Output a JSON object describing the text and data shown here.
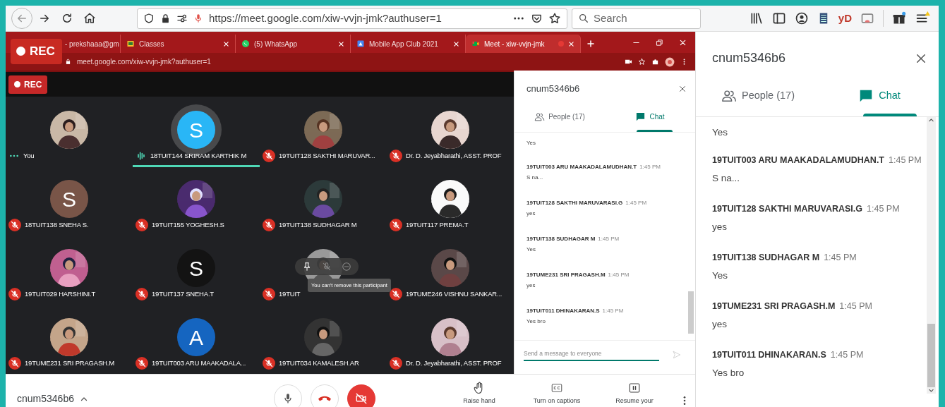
{
  "browser": {
    "url": "https://meet.google.com/xiw-vvjn-jmk?authuser=1",
    "search_placeholder": "Search",
    "extension_label": "yD"
  },
  "recording_badge": "REC",
  "chrome": {
    "tabs": [
      {
        "label": "- prekshaaa@gm",
        "selected": false
      },
      {
        "label": "Classes",
        "kind": "classroom",
        "selected": false
      },
      {
        "label": "(5) WhatsApp",
        "kind": "whatsapp",
        "selected": false
      },
      {
        "label": "Mobile App Club 2021",
        "kind": "app",
        "selected": false
      },
      {
        "label": "Meet - xiw-vvjn-jmk",
        "kind": "meet",
        "selected": true
      }
    ],
    "address": "meet.google.com/xiw-vvjn-jmk?authuser=1"
  },
  "meet": {
    "rec_button": "REC",
    "participants": [
      {
        "name": "You",
        "muted": false,
        "speaking": false,
        "hovered": false
      },
      {
        "name": "18TUIT144 SRIRAM KARTHIK M",
        "kind": "letter",
        "letter": "S",
        "color": "#29b6f6",
        "muted": false,
        "speaking": true,
        "hovered": false
      },
      {
        "name": "19TUIT128 SAKTHI MARUVAR...",
        "muted": true,
        "speaking": false,
        "hovered": false
      },
      {
        "name": "Dr. D. Jeyabharathi, ASST. PROF",
        "muted": true,
        "speaking": false,
        "hovered": false
      },
      {
        "name": "18TUIT138 SNEHA S.",
        "kind": "letter",
        "letter": "S",
        "color": "#795548",
        "muted": true,
        "speaking": false,
        "hovered": false
      },
      {
        "name": "19TUIT155 YOGHESH.S",
        "muted": true,
        "speaking": false,
        "hovered": false
      },
      {
        "name": "19TUIT138 SUDHAGAR M",
        "muted": true,
        "speaking": false,
        "hovered": false
      },
      {
        "name": "19TUIT117 PREMA.T",
        "muted": true,
        "speaking": false,
        "hovered": false
      },
      {
        "name": "19TUIT029 HARSHINI.T",
        "muted": true,
        "speaking": false,
        "hovered": false
      },
      {
        "name": "19TUIT137 SNEHA.T",
        "kind": "letter",
        "letter": "S",
        "color": "#131313",
        "muted": true,
        "speaking": false,
        "hovered": false
      },
      {
        "name": "19TUIT",
        "muted": true,
        "speaking": false,
        "hovered": true,
        "tooltip": "You can't remove this participant"
      },
      {
        "name": "19TUME246 VISHNU SANKAR...",
        "muted": true,
        "speaking": false,
        "hovered": false
      },
      {
        "name": "19TUME231 SRI PRAGASH.M",
        "muted": true,
        "speaking": false,
        "hovered": false
      },
      {
        "name": "19TUIT003 ARU MAAKADALA...",
        "kind": "letter",
        "letter": "A",
        "color": "#1565c0",
        "muted": true,
        "speaking": false,
        "hovered": false
      },
      {
        "name": "19TUIT034 KAMALESH.AR",
        "muted": true,
        "speaking": false,
        "hovered": false
      },
      {
        "name": "Dr. D. Jeyabharathi, ASST. PROF",
        "muted": true,
        "speaking": false,
        "hovered": false
      }
    ],
    "chat_panel": {
      "title": "cnum5346b6",
      "tabs": [
        {
          "label": "People (17)",
          "kind": "people",
          "selected": false
        },
        {
          "label": "Chat",
          "kind": "chat",
          "selected": true
        }
      ],
      "messages": [
        {
          "text": "Yes"
        },
        {
          "sender": "19TUIT003 ARU MAAKADALAMUDHAN.T",
          "time": "1:45 PM",
          "text": "S na..."
        },
        {
          "sender": "19TUIT128 SAKTHI MARUVARASI.G",
          "time": "1:45 PM",
          "text": "yes"
        },
        {
          "sender": "19TUIT138 SUDHAGAR M",
          "time": "1:45 PM",
          "text": "Yes"
        },
        {
          "sender": "19TUME231 SRI PRAGASH.M",
          "time": "1:45 PM",
          "text": "yes"
        },
        {
          "sender": "19TUIT011 DHINAKARAN.S",
          "time": "1:45 PM",
          "text": "Yes bro"
        }
      ],
      "input_placeholder": "Send a message to everyone"
    },
    "bottom_bar": {
      "meeting_code": "cnum5346b6",
      "actions": [
        {
          "label": "Raise hand",
          "kind": "hand"
        },
        {
          "label": "Turn on captions",
          "kind": "captions"
        },
        {
          "label": "Resume your",
          "kind": "present"
        }
      ]
    }
  },
  "side_panel": {
    "title": "cnum5346b6",
    "tabs": [
      {
        "label": "People (17)",
        "kind": "people",
        "selected": false
      },
      {
        "label": "Chat",
        "kind": "chat",
        "selected": true
      }
    ],
    "messages": [
      {
        "text": "Yes"
      },
      {
        "sender": "19TUIT003 ARU MAAKADALAMUDHAN.T",
        "time": "1:45 PM",
        "text": "S na..."
      },
      {
        "sender": "19TUIT128 SAKTHI MARUVARASI.G",
        "time": "1:45 PM",
        "text": "yes"
      },
      {
        "sender": "19TUIT138 SUDHAGAR M",
        "time": "1:45 PM",
        "text": "Yes"
      },
      {
        "sender": "19TUME231 SRI PRAGASH.M",
        "time": "1:45 PM",
        "text": "yes"
      },
      {
        "sender": "19TUIT011 DHINAKARAN.S",
        "time": "1:45 PM",
        "text": "Yes bro"
      }
    ]
  }
}
